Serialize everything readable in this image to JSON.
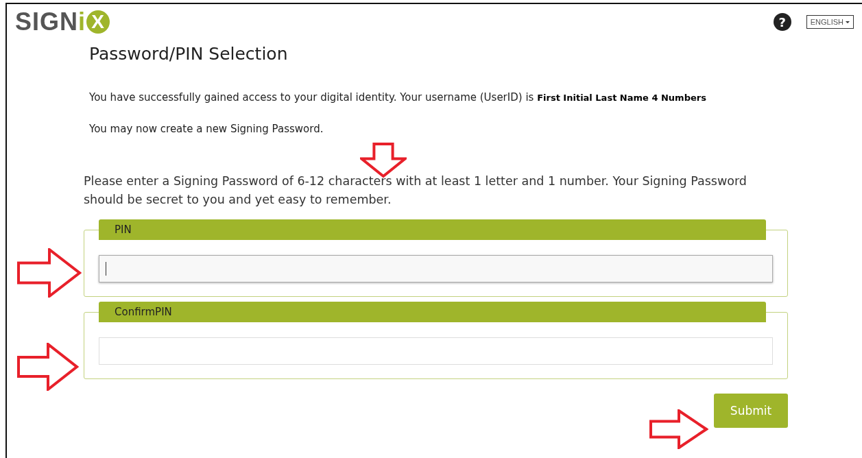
{
  "logo": {
    "main": "SIGN",
    "accent": "i",
    "badge": "X"
  },
  "header": {
    "help": "?",
    "language": "ENGLISH"
  },
  "title": "Password/PIN Selection",
  "intro": "You have successfully gained access to your digital identity. Your username (UserID) is **First Initial Last Name 4 Numbers**",
  "note": "You may now create a new Signing Password.",
  "instructions": "Please enter a Signing Password of 6-12 characters with at least 1 letter and 1 number. Your Signing Password should be secret to you and yet easy to remember.",
  "fields": [
    {
      "legend": "PIN",
      "focused": true
    },
    {
      "legend": "ConfirmPIN",
      "focused": false
    }
  ],
  "submit": "Submit"
}
